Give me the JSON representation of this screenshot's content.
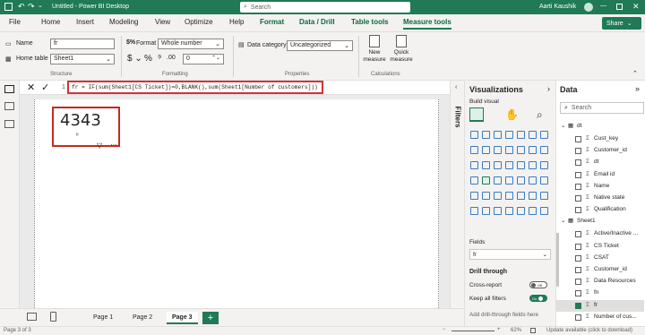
{
  "title_bar": {
    "doc_title": "Untitled - Power BI Desktop",
    "search_placeholder": "Search",
    "user": "Aarti Kaushik"
  },
  "menu": {
    "tabs": [
      "File",
      "Home",
      "Insert",
      "Modeling",
      "View",
      "Optimize",
      "Help"
    ],
    "context_tabs": [
      "Format",
      "Data / Drill",
      "Table tools",
      "Measure tools"
    ],
    "active_tab": "Measure tools",
    "share_label": "Share"
  },
  "ribbon": {
    "name_label": "Name",
    "name_value": "fr",
    "home_table_label": "Home table",
    "home_table_value": "Sheet1",
    "structure_label": "Structure",
    "format_label": "Format",
    "format_value": "Whole number",
    "decimal_value": "0",
    "formatting_label": "Formatting",
    "data_category_label": "Data category",
    "data_category_value": "Uncategorized",
    "properties_label": "Properties",
    "new_measure_label": "New measure",
    "quick_measure_label": "Quick measure",
    "calculations_label": "Calculations"
  },
  "formula": {
    "line_number": "1",
    "text": "fr = IF(sum(Sheet1[CS Ticket])=0,BLANK(),sum(Sheet1[Number of customers]))"
  },
  "card": {
    "value": "4343",
    "caption": "fr"
  },
  "filters_label": "Filters",
  "visualizations": {
    "title": "Visualizations",
    "build_visual": "Build visual",
    "fields_label": "Fields",
    "fields_value": "fr",
    "drill_through": "Drill through",
    "cross_report": "Cross-report",
    "cross_report_state": "Off",
    "keep_all_filters": "Keep all filters",
    "keep_all_filters_state": "On",
    "add_drill_fields": "Add drill-through fields here"
  },
  "data_pane": {
    "title": "Data",
    "search_placeholder": "Search",
    "tables": [
      {
        "name": "dt",
        "fields": [
          "Cust_key",
          "Customer_id",
          "dt",
          "Email id",
          "Name",
          "Native state",
          "Qualification"
        ]
      },
      {
        "name": "Sheet1",
        "fields": [
          "Active/Inactive ...",
          "CS Ticket",
          "CSAT",
          "Customer_id",
          "Data Resources",
          "fn",
          "fr",
          "Number of cus..."
        ]
      }
    ]
  },
  "page_tabs": [
    "Page 1",
    "Page 2",
    "Page 3"
  ],
  "active_page": "Page 3",
  "status": {
    "page_info": "Page 3 of 3",
    "zoom": "62%",
    "update_msg": "Update available (click to download)"
  },
  "colors": {
    "accent": "#1f7a55",
    "highlight": "#d13438",
    "toggle_on": "#1f7a55"
  }
}
